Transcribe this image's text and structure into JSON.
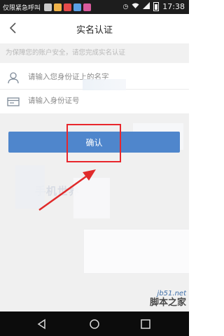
{
  "status_bar": {
    "carrier": "仅限紧急呼叫",
    "time": "17:38",
    "app_icon_colors": [
      "#c9c9c9",
      "#f0b34a",
      "#e54b4b",
      "#5aa0e6",
      "#d85a9c"
    ]
  },
  "header": {
    "back_icon": "chevron-left-icon",
    "title": "实名认证"
  },
  "notice": {
    "text": "为保障您的账户安全，请您完成实名认证"
  },
  "form": {
    "name_field": {
      "icon": "person-icon",
      "placeholder": "请输入您身份证上的名字",
      "value": ""
    },
    "id_field": {
      "icon": "id-card-icon",
      "placeholder": "请输入身份证号",
      "value": ""
    }
  },
  "confirm_button": {
    "label": "确认"
  },
  "colors": {
    "accent": "#4f86cc",
    "annotation_red": "#e8262c",
    "body_bg": "#f0f0f0"
  },
  "watermarks": {
    "middle": "手机世界",
    "site_domain": "jb51.net",
    "site_name": "脚本之家"
  },
  "navigation_bar": {
    "back_icon": "triangle-back-icon",
    "home_icon": "circle-home-icon",
    "recent_icon": "square-recent-icon"
  }
}
